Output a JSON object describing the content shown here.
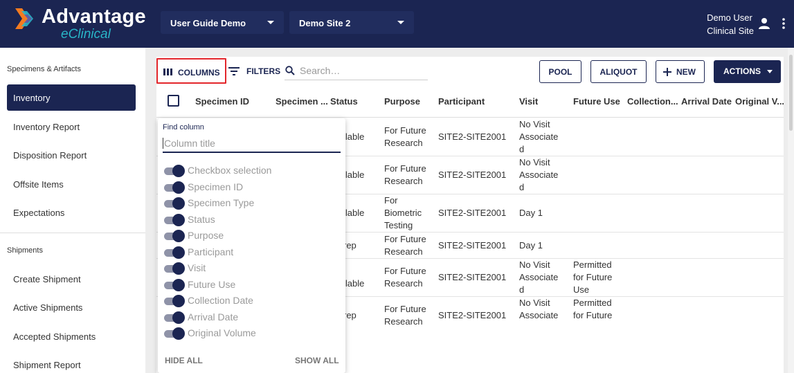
{
  "header": {
    "brand_title": "Advantage",
    "brand_sub": "eClinical",
    "study_select": "User Guide Demo",
    "site_select": "Demo Site 2",
    "user_name": "Demo User",
    "user_role": "Clinical Site"
  },
  "sidebar": {
    "section1": "Specimens & Artifacts",
    "items1": [
      "Inventory",
      "Inventory Report",
      "Disposition Report",
      "Offsite Items",
      "Expectations"
    ],
    "section2": "Shipments",
    "items2": [
      "Create Shipment",
      "Active Shipments",
      "Accepted Shipments",
      "Shipment Report"
    ]
  },
  "toolbar": {
    "columns": "COLUMNS",
    "filters": "FILTERS",
    "search_placeholder": "Search…",
    "pool": "POOL",
    "aliquot": "ALIQUOT",
    "new": "NEW",
    "actions": "ACTIONS"
  },
  "table": {
    "headers": [
      "Specimen ID",
      "Specimen ...",
      "Status",
      "Purpose",
      "Participant",
      "Visit",
      "Future Use",
      "Collection...",
      "Arrival Date",
      "Original V..."
    ],
    "rows": [
      {
        "status": "ilable",
        "purpose": "For Future\nResearch",
        "participant": "SITE2-SITE2001",
        "visit": "No Visit\nAssociate\nd",
        "future": ""
      },
      {
        "status": "ilable",
        "purpose": "For Future\nResearch",
        "participant": "SITE2-SITE2001",
        "visit": "No Visit\nAssociate\nd",
        "future": ""
      },
      {
        "status": "ilable",
        "purpose": "For\nBiometric\nTesting",
        "participant": "SITE2-SITE2001",
        "visit": "Day 1",
        "future": ""
      },
      {
        "status": "rep",
        "purpose": "For Future\nResearch",
        "participant": "SITE2-SITE2001",
        "visit": "Day 1",
        "future": ""
      },
      {
        "status": "ilable",
        "purpose": "For Future\nResearch",
        "participant": "SITE2-SITE2001",
        "visit": "No Visit\nAssociate\nd",
        "future": "Permitted\nfor Future\nUse"
      },
      {
        "status": "rep",
        "purpose": "For Future\nResearch",
        "participant": "SITE2-SITE2001",
        "visit": "No Visit\nAssociate",
        "future": "Permitted\nfor Future"
      }
    ]
  },
  "column_picker": {
    "find_label": "Find column",
    "find_placeholder": "Column title",
    "columns": [
      {
        "label": "Checkbox selection",
        "on": true
      },
      {
        "label": "Specimen ID",
        "on": true
      },
      {
        "label": "Specimen Type",
        "on": true
      },
      {
        "label": "Status",
        "on": true
      },
      {
        "label": "Purpose",
        "on": true
      },
      {
        "label": "Participant",
        "on": true
      },
      {
        "label": "Visit",
        "on": true
      },
      {
        "label": "Future Use",
        "on": true
      },
      {
        "label": "Collection Date",
        "on": true
      },
      {
        "label": "Arrival Date",
        "on": true
      },
      {
        "label": "Original Volume",
        "on": true
      }
    ],
    "hide_all": "HIDE ALL",
    "show_all": "SHOW ALL"
  },
  "colors": {
    "navy": "#1b2552",
    "accent_teal": "#29b5c7",
    "highlight_red": "#e3262b"
  }
}
